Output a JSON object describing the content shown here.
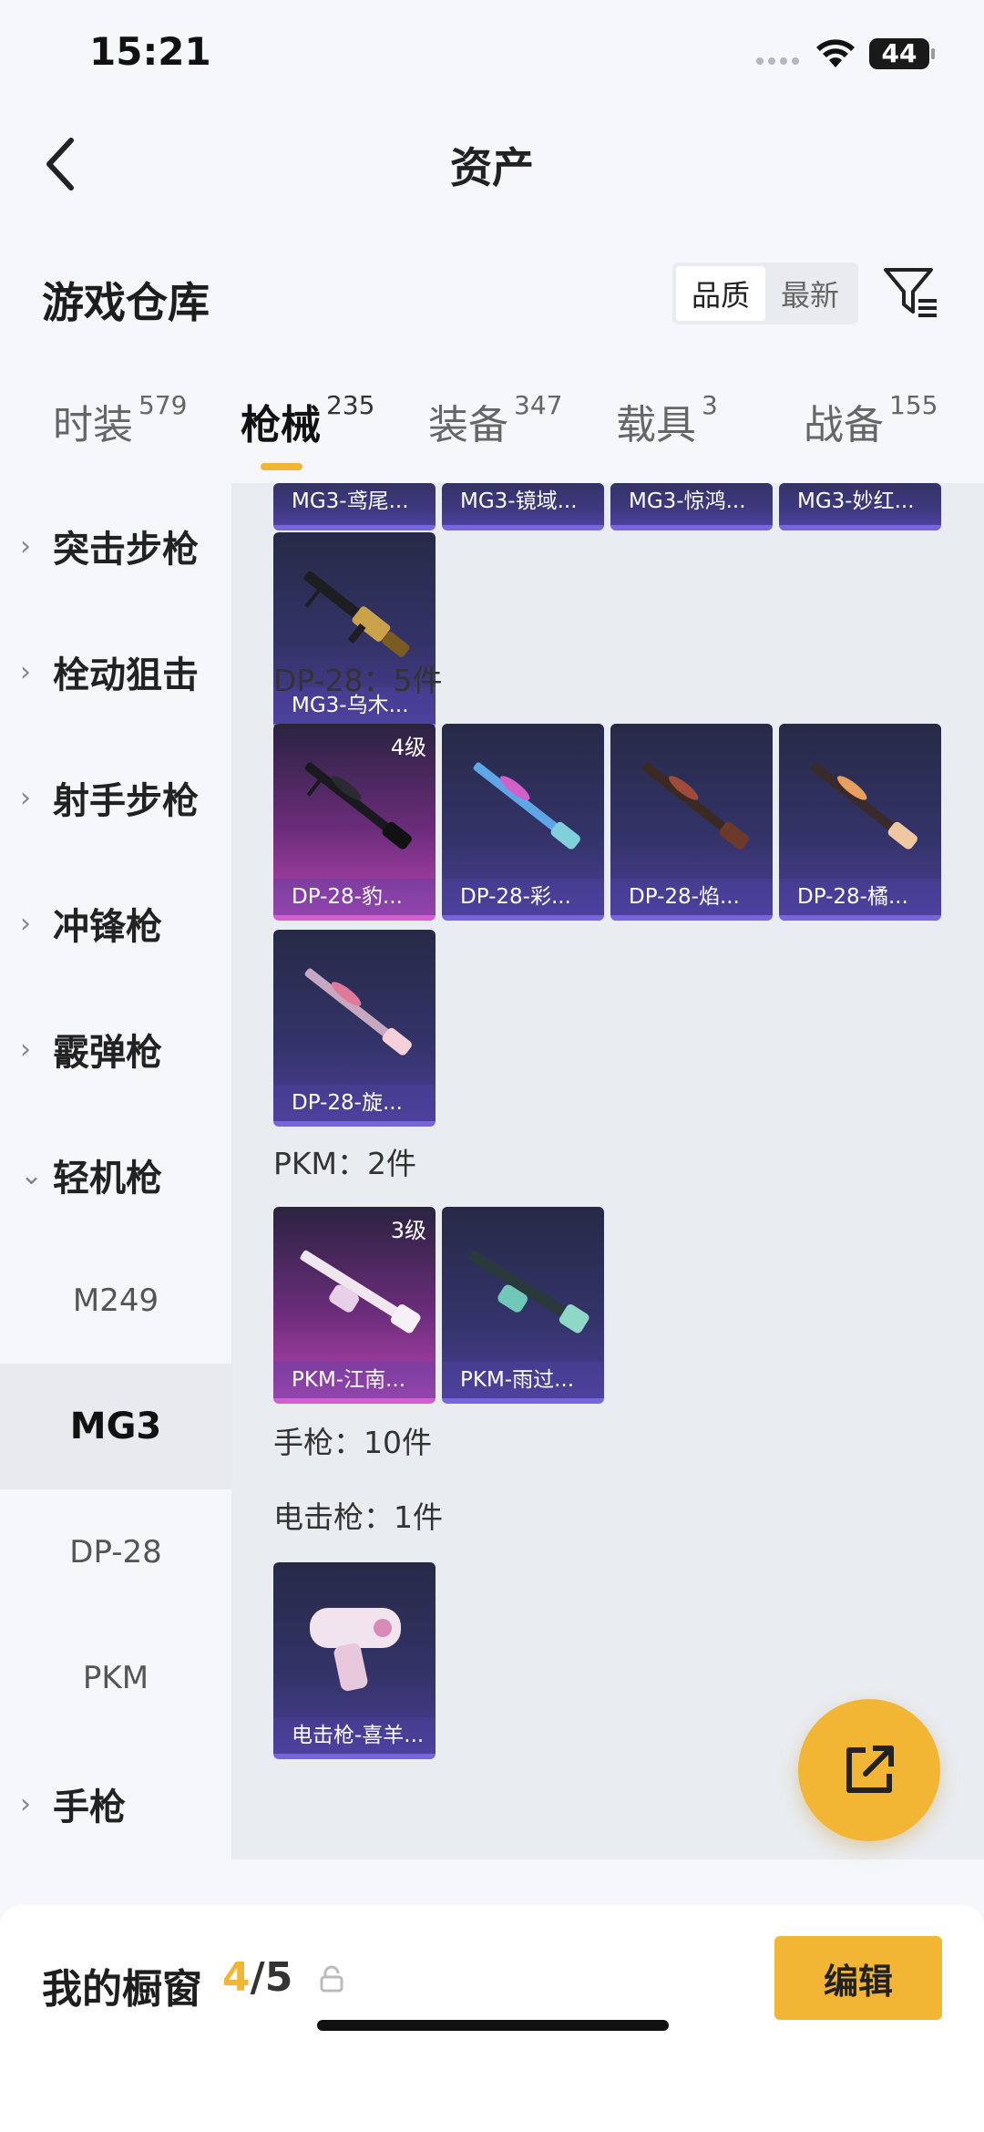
{
  "status_bar": {
    "time": "15:21",
    "battery": "44"
  },
  "header": {
    "title": "资产"
  },
  "warehouse": {
    "title": "游戏仓库",
    "sort_options": [
      "品质",
      "最新"
    ],
    "sort_selected": "品质"
  },
  "tabs": [
    {
      "label": "时装",
      "count": "579"
    },
    {
      "label": "枪械",
      "count": "235",
      "active": true
    },
    {
      "label": "装备",
      "count": "347"
    },
    {
      "label": "载具",
      "count": "3"
    },
    {
      "label": "战备",
      "count": "155"
    }
  ],
  "sidebar": {
    "categories": [
      "突击步枪",
      "栓动狙击",
      "射手步枪",
      "冲锋枪",
      "霰弹枪",
      "轻机枪"
    ],
    "subitems": [
      "M249",
      "MG3",
      "DP-28",
      "PKM"
    ],
    "selected_sub": "MG3",
    "last_category": "手枪"
  },
  "content": {
    "mg3_row_cut": [
      "MG3-鸢尾...",
      "MG3-镜域...",
      "MG3-惊鸿...",
      "MG3-妙红..."
    ],
    "mg3_extra": {
      "name": "MG3-乌木..."
    },
    "dp28": {
      "title": "DP-28：5件",
      "items": [
        {
          "name": "DP-28-豹...",
          "level": "4级"
        },
        {
          "name": "DP-28-彩..."
        },
        {
          "name": "DP-28-焰..."
        },
        {
          "name": "DP-28-橘..."
        },
        {
          "name": "DP-28-旋..."
        }
      ]
    },
    "pkm": {
      "title": "PKM：2件",
      "items": [
        {
          "name": "PKM-江南...",
          "level": "3级"
        },
        {
          "name": "PKM-雨过..."
        }
      ]
    },
    "pistol": {
      "title": "手枪：10件"
    },
    "taser": {
      "title": "电击枪：1件",
      "items": [
        {
          "name": "电击枪-喜羊..."
        }
      ]
    }
  },
  "bottom_bar": {
    "title": "我的橱窗",
    "current": "4",
    "total": "/5",
    "edit_label": "编辑"
  },
  "colors": {
    "accent": "#f3b634",
    "card_purple": "#34336a",
    "card_pink": "#b544b0"
  }
}
